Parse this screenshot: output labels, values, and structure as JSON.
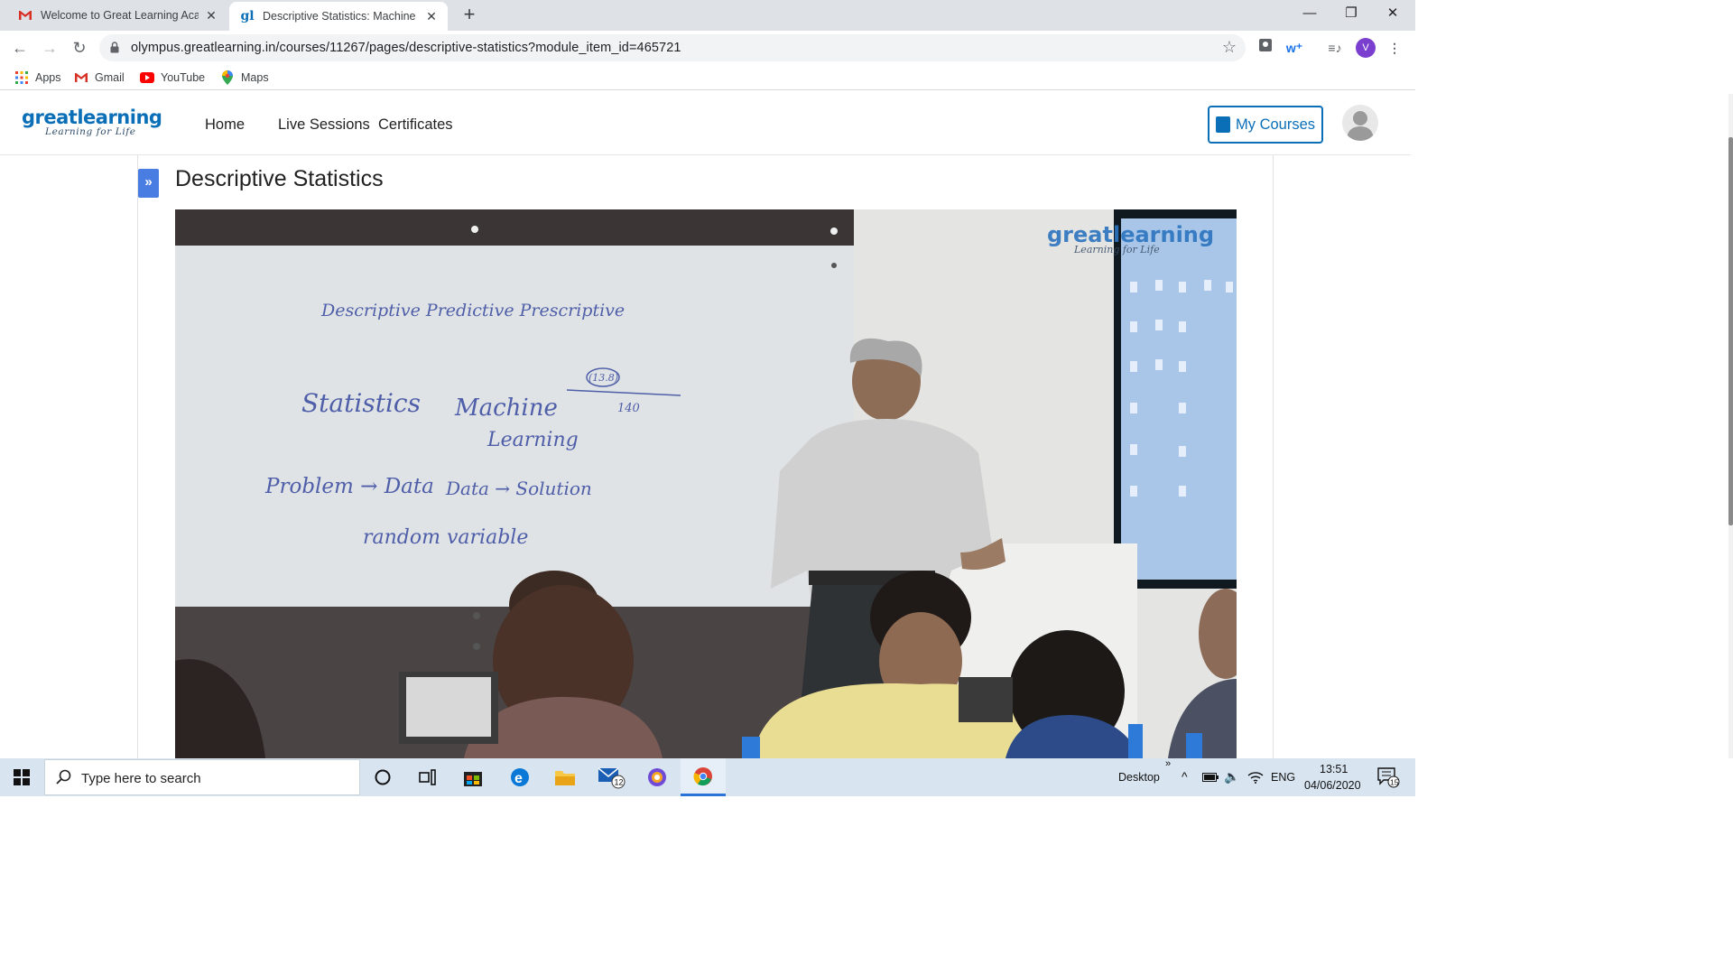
{
  "browser": {
    "tabs": [
      {
        "title": "Welcome to Great Learning Acad",
        "active": false,
        "favicon": "gmail-icon"
      },
      {
        "title": "Descriptive Statistics: Machine Le",
        "active": true,
        "favicon": "greatlearning-icon"
      }
    ],
    "url": "olympus.greatlearning.in/courses/11267/pages/descriptive-statistics?module_item_id=465721",
    "profile_initial": "V",
    "bookmarks": [
      {
        "label": "Apps",
        "icon": "apps-grid-icon"
      },
      {
        "label": "Gmail",
        "icon": "gmail-icon"
      },
      {
        "label": "YouTube",
        "icon": "youtube-icon"
      },
      {
        "label": "Maps",
        "icon": "maps-pin-icon"
      }
    ]
  },
  "site": {
    "logo_main": "greatlearning",
    "logo_tagline": "Learning for Life",
    "nav": [
      "Home",
      "Live Sessions",
      "Certificates"
    ],
    "my_courses": "My Courses"
  },
  "page": {
    "title": "Descriptive Statistics",
    "sidebar_toggle": "»",
    "video": {
      "watermark_main": "greatlearning",
      "watermark_sub": "Learning for Life",
      "whiteboard": [
        "Descriptive Predictive Prescriptive",
        "(13.8)",
        "140",
        "Statistics",
        "Machine",
        "Learning",
        "Problem → Data",
        "Data → Solution",
        "random variable"
      ]
    }
  },
  "taskbar": {
    "search_placeholder": "Type here to search",
    "desktop_label": "Desktop",
    "language": "ENG",
    "time": "13:51",
    "date": "04/06/2020",
    "mail_badge": "12",
    "notif_badge": "15"
  },
  "colors": {
    "brand": "#0b6fb7",
    "toggle": "#4a7de2",
    "taskbar": "#d8e4f0"
  }
}
